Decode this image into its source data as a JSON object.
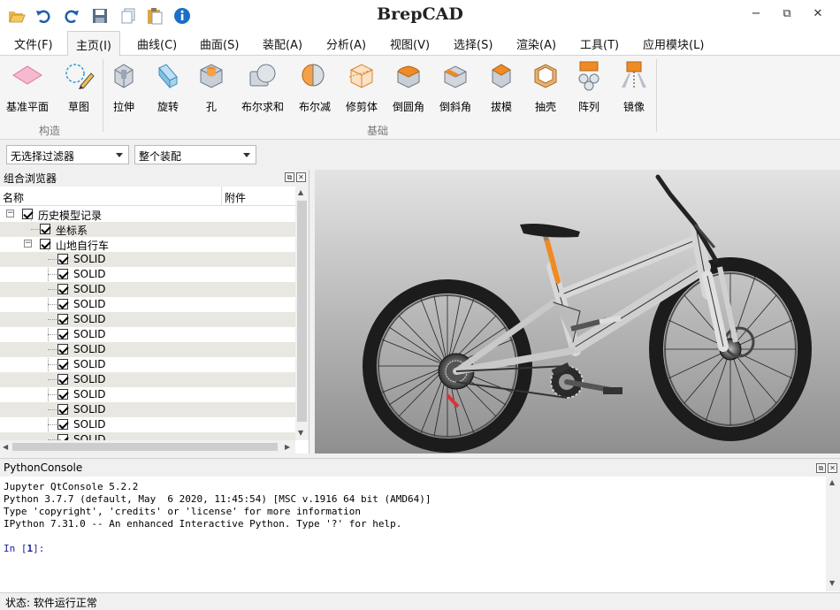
{
  "app": {
    "title": "BrepCAD"
  },
  "quick_access": [
    {
      "name": "open-icon"
    },
    {
      "name": "undo-icon"
    },
    {
      "name": "redo-icon"
    },
    {
      "name": "save-icon"
    },
    {
      "name": "copy-icon"
    },
    {
      "name": "paste-icon"
    },
    {
      "name": "info-icon"
    }
  ],
  "window_buttons": {
    "minimize": "−",
    "restore": "⧉",
    "close": "✕"
  },
  "menu": {
    "tabs": [
      "文件(F)",
      "主页(I)",
      "曲线(C)",
      "曲面(S)",
      "装配(A)",
      "分析(A)",
      "视图(V)",
      "选择(S)",
      "渲染(A)",
      "工具(T)",
      "应用模块(L)"
    ],
    "active": "主页(I)"
  },
  "ribbon": {
    "groups": [
      {
        "name": "构造",
        "buttons": [
          "基准平面",
          "草图"
        ]
      },
      {
        "name": "基础",
        "buttons": [
          "拉伸",
          "旋转",
          "孔",
          "布尔求和",
          "布尔减",
          "修剪体",
          "倒圆角",
          "倒斜角",
          "拔模",
          "抽壳",
          "阵列",
          "镜像"
        ]
      }
    ]
  },
  "filters": {
    "selection_filter": "无选择过滤器",
    "assembly_scope": "整个装配"
  },
  "combo_browser": {
    "title": "组合浏览器",
    "columns": [
      "名称",
      "附件"
    ],
    "rows": [
      {
        "label": "历史模型记录",
        "level": 0
      },
      {
        "label": "坐标系",
        "level": 1
      },
      {
        "label": "山地自行车",
        "level": 1
      },
      {
        "label": "SOLID",
        "level": 2
      },
      {
        "label": "SOLID",
        "level": 2
      },
      {
        "label": "SOLID",
        "level": 2
      },
      {
        "label": "SOLID",
        "level": 2
      },
      {
        "label": "SOLID",
        "level": 2
      },
      {
        "label": "SOLID",
        "level": 2
      },
      {
        "label": "SOLID",
        "level": 2
      },
      {
        "label": "SOLID",
        "level": 2
      },
      {
        "label": "SOLID",
        "level": 2
      },
      {
        "label": "SOLID",
        "level": 2
      },
      {
        "label": "SOLID",
        "level": 2
      },
      {
        "label": "SOLID",
        "level": 2
      },
      {
        "label": "SOLID",
        "level": 2
      }
    ]
  },
  "console": {
    "title": "PythonConsole",
    "lines": [
      "Jupyter QtConsole 5.2.2",
      "Python 3.7.7 (default, May  6 2020, 11:45:54) [MSC v.1916 64 bit (AMD64)]",
      "Type 'copyright', 'credits' or 'license' for more information",
      "IPython 7.31.0 -- An enhanced Interactive Python. Type '?' for help."
    ],
    "prompt_prefix": "In [",
    "prompt_number": "1",
    "prompt_suffix": "]:"
  },
  "status": {
    "text": "状态: 软件运行正常"
  },
  "colors": {
    "accent_orange": "#f08a24",
    "info_blue": "#1a6fc7",
    "arrow_blue": "#1f5fa8"
  }
}
